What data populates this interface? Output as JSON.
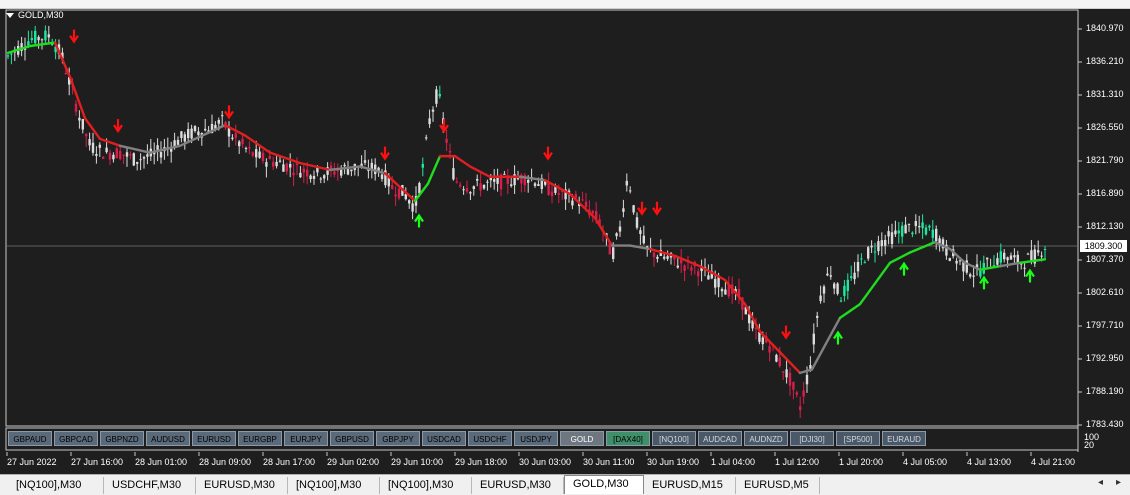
{
  "window": {
    "symbol_title": "GOLD,M30"
  },
  "colors": {
    "background": "#1e1e1e",
    "bull_candle": "#1ee8a0",
    "bear_candle": "#d81e4a",
    "neutral_candle": "#dcdcdc",
    "trend_up": "#1fdc1f",
    "trend_down": "#e02020",
    "trend_flat": "#808080",
    "arrow_up": "#18ff18",
    "arrow_down": "#ff1010"
  },
  "price_axis": {
    "labels": [
      "1840.970",
      "1836.210",
      "1831.310",
      "1826.550",
      "1821.790",
      "1816.890",
      "1812.130",
      "1807.370",
      "1802.610",
      "1797.710",
      "1792.950",
      "1788.190",
      "1783.430"
    ],
    "current": "1809.300"
  },
  "oscillator_axis": {
    "labels": [
      "100",
      "20"
    ]
  },
  "time_axis": {
    "labels": [
      "27 Jun 2022",
      "27 Jun 16:00",
      "28 Jun 01:00",
      "28 Jun 09:00",
      "28 Jun 17:00",
      "29 Jun 02:00",
      "29 Jun 10:00",
      "29 Jun 18:00",
      "30 Jun 03:00",
      "30 Jun 11:00",
      "30 Jun 19:00",
      "1 Jul 04:00",
      "1 Jul 12:00",
      "1 Jul 20:00",
      "4 Jul 05:00",
      "4 Jul 13:00",
      "4 Jul 21:00"
    ]
  },
  "symbol_buttons": [
    {
      "label": "GBPAUD",
      "style": "normal"
    },
    {
      "label": "GBPCAD",
      "style": "normal"
    },
    {
      "label": "GBPNZD",
      "style": "normal"
    },
    {
      "label": "AUDUSD",
      "style": "normal"
    },
    {
      "label": "EURUSD",
      "style": "normal"
    },
    {
      "label": "EURGBP",
      "style": "normal"
    },
    {
      "label": "EURJPY",
      "style": "normal"
    },
    {
      "label": "GBPUSD",
      "style": "normal"
    },
    {
      "label": "GBPJPY",
      "style": "normal"
    },
    {
      "label": "USDCAD",
      "style": "normal"
    },
    {
      "label": "USDCHF",
      "style": "normal"
    },
    {
      "label": "USDJPY",
      "style": "normal"
    },
    {
      "label": "GOLD",
      "style": "active-gray"
    },
    {
      "label": "[DAX40]",
      "style": "active-green"
    },
    {
      "label": "[NQ100]",
      "style": "dark"
    },
    {
      "label": "AUDCAD",
      "style": "dark"
    },
    {
      "label": "AUDNZD",
      "style": "dark"
    },
    {
      "label": "[DJI30]",
      "style": "dark"
    },
    {
      "label": "[SP500]",
      "style": "dark"
    },
    {
      "label": "EURAUD",
      "style": "dark"
    }
  ],
  "tabs": [
    {
      "label": "[NQ100],M30",
      "active": false
    },
    {
      "label": "USDCHF,M30",
      "active": false
    },
    {
      "label": "EURUSD,M30",
      "active": false
    },
    {
      "label": "[NQ100],M30",
      "active": false
    },
    {
      "label": "[NQ100],M30",
      "active": false
    },
    {
      "label": "EURUSD,M30",
      "active": false
    },
    {
      "label": "GOLD,M30",
      "active": true
    },
    {
      "label": "EURUSD,M15",
      "active": false
    },
    {
      "label": "EURUSD,M5",
      "active": false
    }
  ],
  "nav": {
    "left": "◂",
    "right": "▸"
  }
}
